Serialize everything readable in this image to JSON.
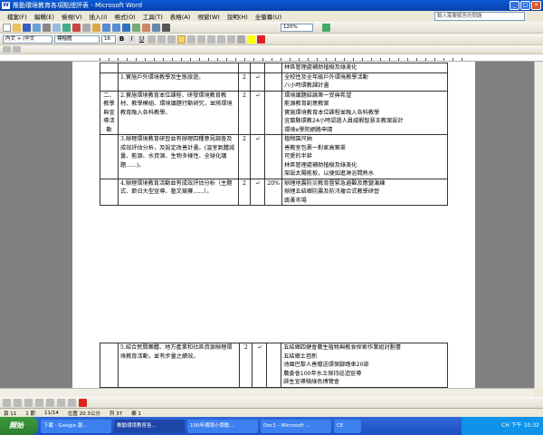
{
  "window": {
    "title": "推動環境教育各項點總評表 - Microsoft Word"
  },
  "menu": [
    "檔案(F)",
    "編輯(E)",
    "檢視(V)",
    "插入(I)",
    "格式(O)",
    "工具(T)",
    "表格(A)",
    "視窗(W)",
    "說明(H)",
    "全螢幕(U)"
  ],
  "help_placeholder": "輸入需要解答的問題",
  "format": {
    "style": "內文 + (中文",
    "font": "標楷體",
    "size": "16",
    "zoom": "120%"
  },
  "page1_rows": [
    {
      "num": "",
      "item": "",
      "score": "",
      "check": "",
      "weight": "",
      "notes": [
        "林區管理處補助植樹及綠美化"
      ]
    },
    {
      "num": "",
      "item": "1.實施戶外環境教學及生態旅遊。",
      "score": "2",
      "check": "↵",
      "weight": "",
      "notes": [
        "全校性及全年級戶外環境教學活動",
        "八小時環教課計畫"
      ]
    },
    {
      "num": "二、教學與宣導活動",
      "item": "2.實施環境教育本位課程、研發環境教育教材、教學模組、環境議題行動研究，並將環境教育融入各科教學。",
      "score": "2",
      "check": "↵",
      "weight": "",
      "notes": [
        "環境議題結論第一受與希望",
        "能源教育創意教案",
        "實施環境教育本位課程並融入各科教學",
        "宜蘭縣環教24小時認證人員威蝦智慧王教案設計",
        "環境e學院網路申請"
      ]
    },
    {
      "num": "",
      "item": "3.辦理環境教育研習並有辦理四種意見調查及成效評估分析，及設定改善計畫。(溫室氣體減量、能源、水資源、生物多樣性、全球化議題......)。",
      "score": "2",
      "check": "↵",
      "weight": "",
      "notes": [
        "植物園尺納",
        "善教室包裹一對家高築單",
        "可愛的半蚌",
        "林區管理處補助植樹及綠美化",
        "架設太陽能板，以便如進淋浴間熱水"
      ]
    },
    {
      "num": "",
      "item": "4.辦理環境教育活動並有成效評估分析（主題式、節日大型宣導、藝文競賽......）。",
      "score": "2",
      "check": "↵",
      "weight": "20%",
      "notes": [
        "辦理地震防災教育暨緊急避難及應變演練",
        "辦理五結鄉防震及防汛複合式教學研習",
        "跳蚤市場"
      ]
    }
  ],
  "page2_rows": [
    {
      "num": "",
      "item": "5.結合民間團體、地方產業和社區資源辦理環境教育活動，並有步量之績效。",
      "score": "2",
      "check": "↵",
      "weight": "",
      "notes": [
        "五結鄉四健會農生植物與教食探索作業組討劃書",
        "五結鄉土芭新",
        "池國巴黎人善贈送環保腳踏車20部",
        "農委會100年水土保持巡迴宣導",
        "師生宣導騎綠色博覽會"
      ]
    },
    {
      "num": "",
      "item": "6.推動環保有功事蹟。(如環保有功教師、學生社團、學校、",
      "score": "2",
      "check": "↵",
      "weight": "",
      "notes": [
        "宜梁富關博腳"
      ]
    }
  ],
  "status": {
    "page": "頁 11",
    "section": "1 節",
    "pages": "11/14",
    "pos": "位置 20.3公分",
    "line": "列 37",
    "col": "欄 1"
  },
  "taskbar": {
    "start": "開始",
    "tasks": [
      "下載 - Google 瀏...",
      "推動環境教育各...",
      "100年環境小學動...",
      "Doc1 - Microsoft ...",
      "CE"
    ],
    "lang": "CH",
    "clock": "下午 10:32"
  }
}
